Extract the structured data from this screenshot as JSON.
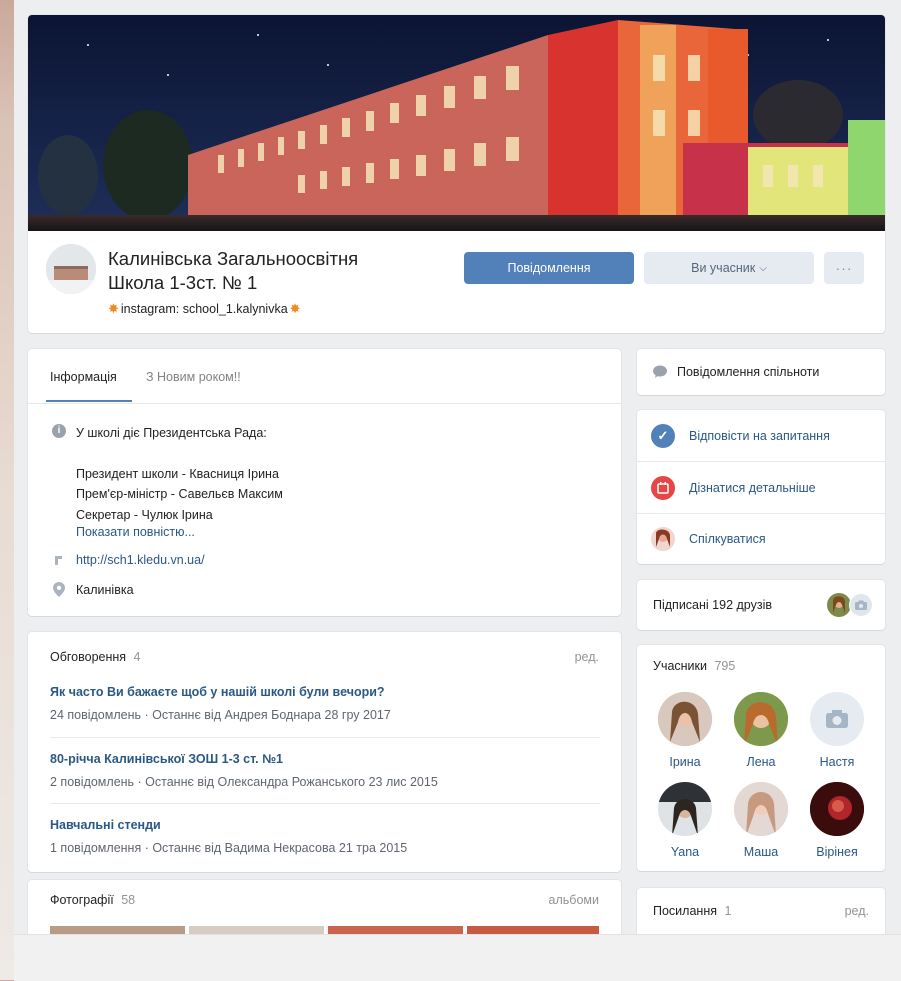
{
  "group": {
    "name_line1": "Калинівська Загальноосвітня",
    "name_line2": "Школа 1-3ст. № 1",
    "status": "instagram: school_1.kalynivka"
  },
  "actions": {
    "message_button": "Повідомлення",
    "member_button": "Ви учасник",
    "more_button": "···"
  },
  "info": {
    "tabs": [
      "Інформація",
      "З Новим роком!!"
    ],
    "desc_title": "У школі діє Президентська Рада:",
    "desc_lines": [
      "Президент школи - Квасниця Ірина",
      "Прем'єр-міністр - Савельєв Максим",
      "Секретар - Чулюк Ірина"
    ],
    "show_full": "Показати повністю...",
    "website": "http://sch1.kledu.vn.ua/",
    "location": "Калинівка"
  },
  "discussions": {
    "title": "Обговорення",
    "count": "4",
    "edit": "ред.",
    "items": [
      {
        "title": "Як часто Ви бажаєте щоб у нашій школі були вечори?",
        "meta": "24 повідомлень · Останнє від Андрея Боднара 28 гру 2017"
      },
      {
        "title": "80-річча Калинівської ЗОШ 1-3 ст. №1",
        "meta": "2 повідомлень · Останнє від Олександра Рожанського 23 лис 2015"
      },
      {
        "title": "Навчальні стенди",
        "meta": "1 повідомлення · Останнє від Вадима Некрасова 21 тра 2015"
      }
    ]
  },
  "photos": {
    "title": "Фотографії",
    "count": "58",
    "albums": "альбоми"
  },
  "sidebar": {
    "community_messages": "Повідомлення спільноти",
    "actions": [
      "Відповісти на запитання",
      "Дізнатися детальніше",
      "Спілкуватися"
    ],
    "friends_label": "Підписані 192 друзів",
    "members_title": "Учасники",
    "members_count": "795",
    "members": [
      "Ірина",
      "Лена",
      "Настя",
      "Yana",
      "Маша",
      "Вірінея"
    ],
    "links_title": "Посилання",
    "links_count": "1",
    "links_edit": "ред."
  },
  "colors": {
    "accent": "#5181b8",
    "link": "#2a5885",
    "muted": "#939393",
    "page_bg": "#edeef0"
  }
}
